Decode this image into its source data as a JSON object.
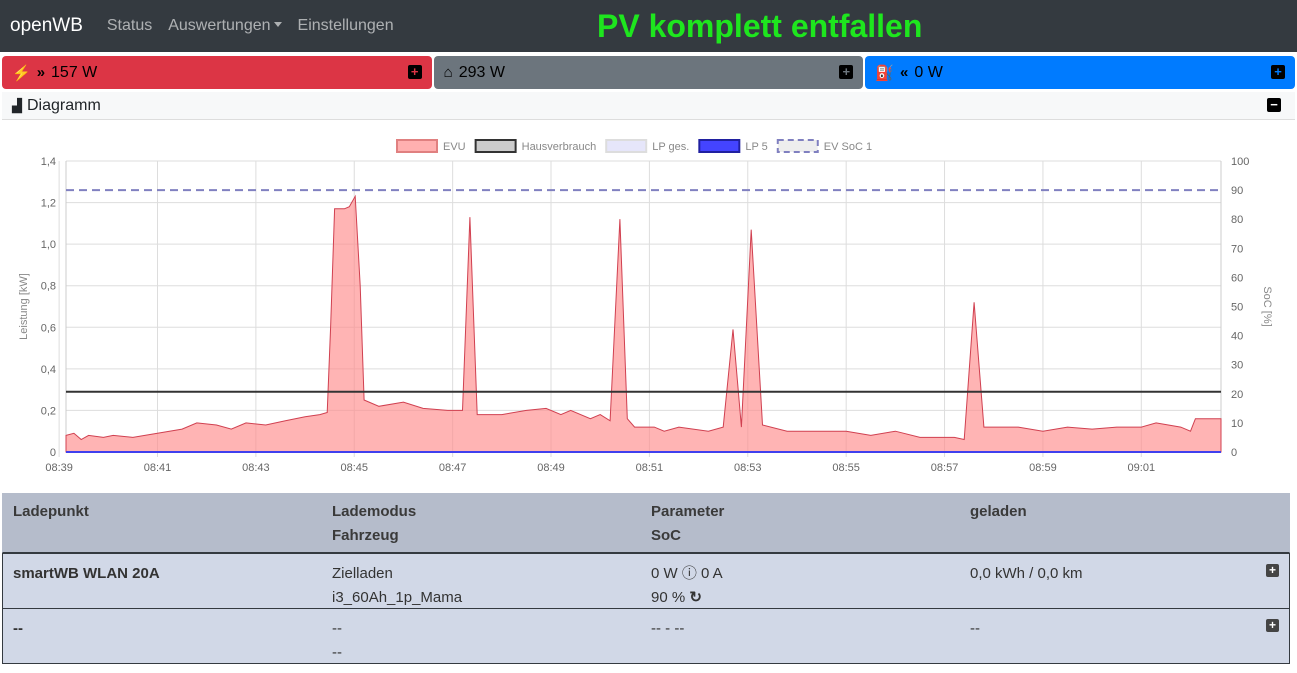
{
  "nav": {
    "brand": "openWB",
    "status": "Status",
    "auswertungen": "Auswertungen",
    "einstellungen": "Einstellungen",
    "banner": "PV komplett entfallen"
  },
  "cards": {
    "evu": "157 W",
    "haus": "293 W",
    "lp": "0 W",
    "plus": "+"
  },
  "diagram": {
    "title": "Diagramm",
    "collapse": "−"
  },
  "colors": {
    "evu": "#dc3545",
    "haus": "#6c757d",
    "lp": "#007bff"
  },
  "chart_data": {
    "type": "area",
    "legend": [
      "EVU",
      "Hausverbrauch",
      "LP ges.",
      "LP 5",
      "EV SoC 1"
    ],
    "ylabel": "Leistung [kW]",
    "y2label": "SoC [%]",
    "ylim": [
      0,
      1.4
    ],
    "y2lim": [
      0,
      100
    ],
    "yticks": [
      "0",
      "0,2",
      "0,4",
      "0,6",
      "0,8",
      "1,0",
      "1,2",
      "1,4"
    ],
    "y2ticks": [
      "0",
      "10",
      "20",
      "30",
      "40",
      "50",
      "60",
      "70",
      "80",
      "90",
      "100"
    ],
    "xticks": [
      "08:39",
      "08:41",
      "08:43",
      "08:45",
      "08:47",
      "08:49",
      "08:51",
      "08:53",
      "08:55",
      "08:57",
      "08:59",
      "09:01"
    ],
    "x_unit": "minutes after 08:39",
    "xlim": [
      0.14,
      23.62
    ],
    "series": [
      {
        "name": "EVU",
        "points": [
          [
            0.14,
            0.08
          ],
          [
            0.3,
            0.09
          ],
          [
            0.45,
            0.06
          ],
          [
            0.6,
            0.08
          ],
          [
            0.9,
            0.07
          ],
          [
            1.1,
            0.08
          ],
          [
            1.5,
            0.07
          ],
          [
            2,
            0.09
          ],
          [
            2.5,
            0.11
          ],
          [
            2.8,
            0.14
          ],
          [
            3.2,
            0.13
          ],
          [
            3.5,
            0.11
          ],
          [
            3.8,
            0.14
          ],
          [
            4.2,
            0.13
          ],
          [
            4.6,
            0.15
          ],
          [
            5,
            0.17
          ],
          [
            5.3,
            0.18
          ],
          [
            5.45,
            0.19
          ],
          [
            5.52,
            0.6
          ],
          [
            5.6,
            1.17
          ],
          [
            5.8,
            1.17
          ],
          [
            5.9,
            1.18
          ],
          [
            6.02,
            1.23
          ],
          [
            6.12,
            0.8
          ],
          [
            6.2,
            0.25
          ],
          [
            6.5,
            0.22
          ],
          [
            7,
            0.24
          ],
          [
            7.4,
            0.21
          ],
          [
            7.9,
            0.2
          ],
          [
            8.2,
            0.2
          ],
          [
            8.35,
            1.13
          ],
          [
            8.5,
            0.18
          ],
          [
            9,
            0.18
          ],
          [
            9.5,
            0.2
          ],
          [
            9.9,
            0.21
          ],
          [
            10.2,
            0.18
          ],
          [
            10.4,
            0.2
          ],
          [
            10.8,
            0.16
          ],
          [
            11.0,
            0.18
          ],
          [
            11.2,
            0.15
          ],
          [
            11.4,
            1.12
          ],
          [
            11.55,
            0.16
          ],
          [
            11.7,
            0.12
          ],
          [
            12.1,
            0.12
          ],
          [
            12.3,
            0.1
          ],
          [
            12.6,
            0.12
          ],
          [
            13.2,
            0.1
          ],
          [
            13.5,
            0.12
          ],
          [
            13.7,
            0.59
          ],
          [
            13.87,
            0.12
          ],
          [
            14.07,
            1.07
          ],
          [
            14.3,
            0.13
          ],
          [
            14.8,
            0.1
          ],
          [
            15.5,
            0.1
          ],
          [
            16,
            0.1
          ],
          [
            16.5,
            0.08
          ],
          [
            17,
            0.1
          ],
          [
            17.5,
            0.07
          ],
          [
            18.2,
            0.07
          ],
          [
            18.4,
            0.06
          ],
          [
            18.6,
            0.72
          ],
          [
            18.8,
            0.12
          ],
          [
            19.5,
            0.12
          ],
          [
            20,
            0.1
          ],
          [
            20.5,
            0.12
          ],
          [
            21,
            0.11
          ],
          [
            21.5,
            0.12
          ],
          [
            22,
            0.12
          ],
          [
            22.3,
            0.14
          ],
          [
            22.8,
            0.12
          ],
          [
            23,
            0.1
          ],
          [
            23.1,
            0.16
          ],
          [
            23.62,
            0.16
          ]
        ]
      },
      {
        "name": "Hausverbrauch",
        "value": 0.29
      },
      {
        "name": "LP ges.",
        "value": 0
      },
      {
        "name": "LP 5",
        "value": 0
      },
      {
        "name": "EV SoC 1",
        "value": 90,
        "axis": "right"
      }
    ]
  },
  "table": {
    "headers": [
      "Ladepunkt",
      "Lademodus",
      "Fahrzeug",
      "Parameter",
      "SoC",
      "geladen"
    ],
    "rows": [
      {
        "name": "smartWB WLAN 20A",
        "mode": "Zielladen",
        "vehicle": "i3_60Ah_1p_Mama",
        "params": "0 W ⓘ 0 A",
        "soc": "90 %",
        "charged": "0,0 kWh / 0,0 km"
      },
      {
        "name": "--",
        "mode": "--",
        "vehicle": "--",
        "params": "-- - --",
        "soc": "",
        "charged": "--"
      }
    ]
  }
}
